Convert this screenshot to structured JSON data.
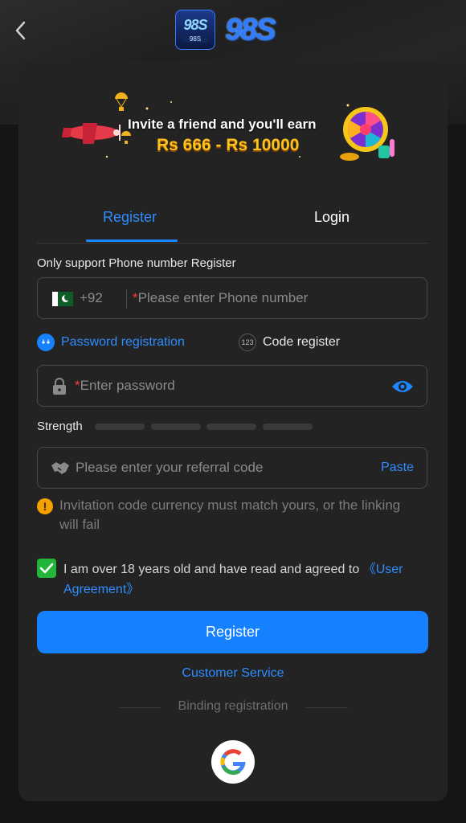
{
  "banner": {
    "line1": "Invite a friend and you'll earn",
    "line2": "Rs 666 - Rs 10000"
  },
  "logo": {
    "badge_text": "98S",
    "badge_sub": "98S",
    "wordmark": "98S"
  },
  "tabs": {
    "register": "Register",
    "login": "Login"
  },
  "form": {
    "phone_label": "Only support Phone number Register",
    "country_code": "+92",
    "required_mark": "*",
    "phone_placeholder": "Please enter Phone number",
    "option_password": "Password registration",
    "option_code": "Code register",
    "code_icon_text": "123",
    "password_placeholder": "Enter password",
    "strength_label": "Strength",
    "referral_placeholder": "Please enter your referral code",
    "paste_label": "Paste",
    "warning_text": "Invitation code currency must match yours, or the linking will fail",
    "agree_text": "I am over 18 years old and have read and agreed to ",
    "agree_link": "《User Agreement》",
    "submit_label": "Register"
  },
  "footer": {
    "customer_service": "Customer Service",
    "binding": "Binding registration"
  },
  "colors": {
    "accent": "#1681ff",
    "check": "#22b53a",
    "warning": "#f4a100",
    "card": "#232323"
  }
}
